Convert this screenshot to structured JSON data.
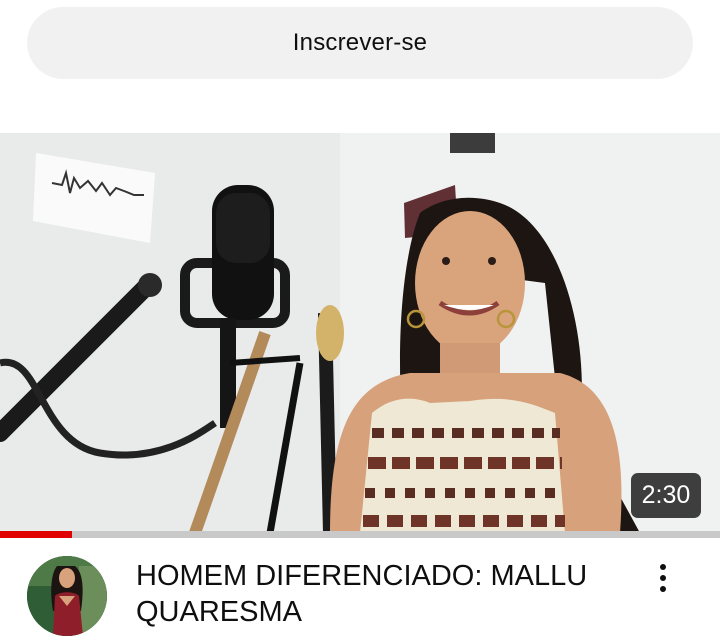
{
  "subscribe": {
    "label": "Inscrever-se"
  },
  "video": {
    "duration": "2:30",
    "progress_fraction": 0.1,
    "title": "HOMEM DIFERENCIADO: MALLU QUARESMA"
  },
  "colors": {
    "progress": "#e00000",
    "subscribe_bg": "#f1f1f1",
    "badge_bg": "#1e1e1e"
  },
  "icons": {
    "more": "more-vert-icon"
  }
}
